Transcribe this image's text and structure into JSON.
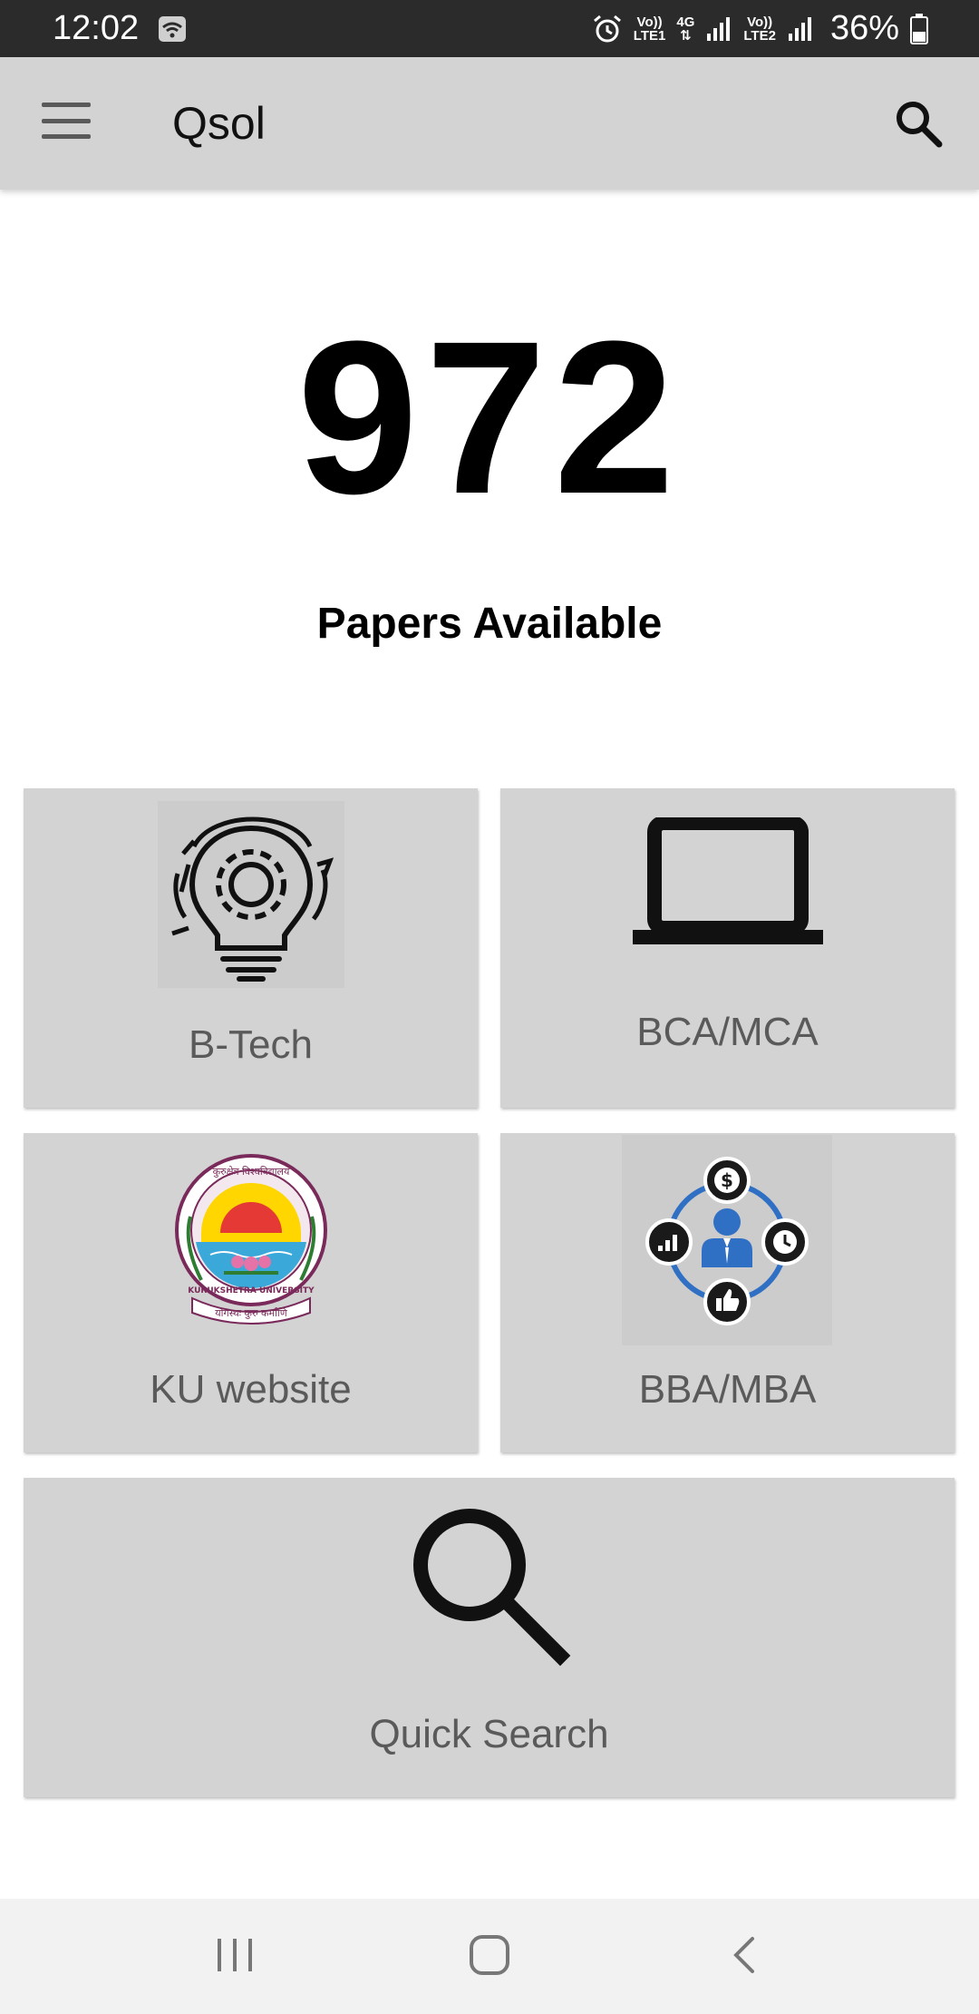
{
  "status_bar": {
    "time": "12:02",
    "sim1_top": "Vo))",
    "sim1_bottom": "LTE1",
    "network": "4G",
    "sim2_top": "Vo))",
    "sim2_bottom": "LTE2",
    "battery": "36%",
    "icons": [
      "wifi-icon",
      "alarm-icon",
      "signal-icon",
      "battery-icon"
    ]
  },
  "app_bar": {
    "title": "Qsol",
    "icons": [
      "hamburger-menu-icon",
      "search-icon"
    ]
  },
  "counter": {
    "count": "972",
    "label": "Papers Available"
  },
  "tiles": [
    {
      "label": "B-Tech",
      "icon": "lightbulb-gear-icon"
    },
    {
      "label": "BCA/MCA",
      "icon": "laptop-icon"
    },
    {
      "label": "KU website",
      "icon": "kurukshetra-university-logo"
    },
    {
      "label": "BBA/MBA",
      "icon": "business-person-icon"
    },
    {
      "label": "Quick Search",
      "icon": "search-icon"
    }
  ],
  "ku_logo": {
    "top_text": "कुरुक्षेत्र विश्वविद्यालय",
    "ring_text": "KURUKSHETRA UNIVERSITY",
    "motto": "योगस्थः कुरु कर्माणि"
  },
  "colors": {
    "app_bar_bg": "#d3d3d3",
    "tile_bg": "#d3d3d3",
    "status_bar_bg": "#2b2b2b",
    "tile_text": "#5a5a5a",
    "accent_blue": "#2f6fc4"
  },
  "nav_bar": {
    "icons": [
      "recent-apps-icon",
      "home-icon",
      "back-icon"
    ]
  }
}
